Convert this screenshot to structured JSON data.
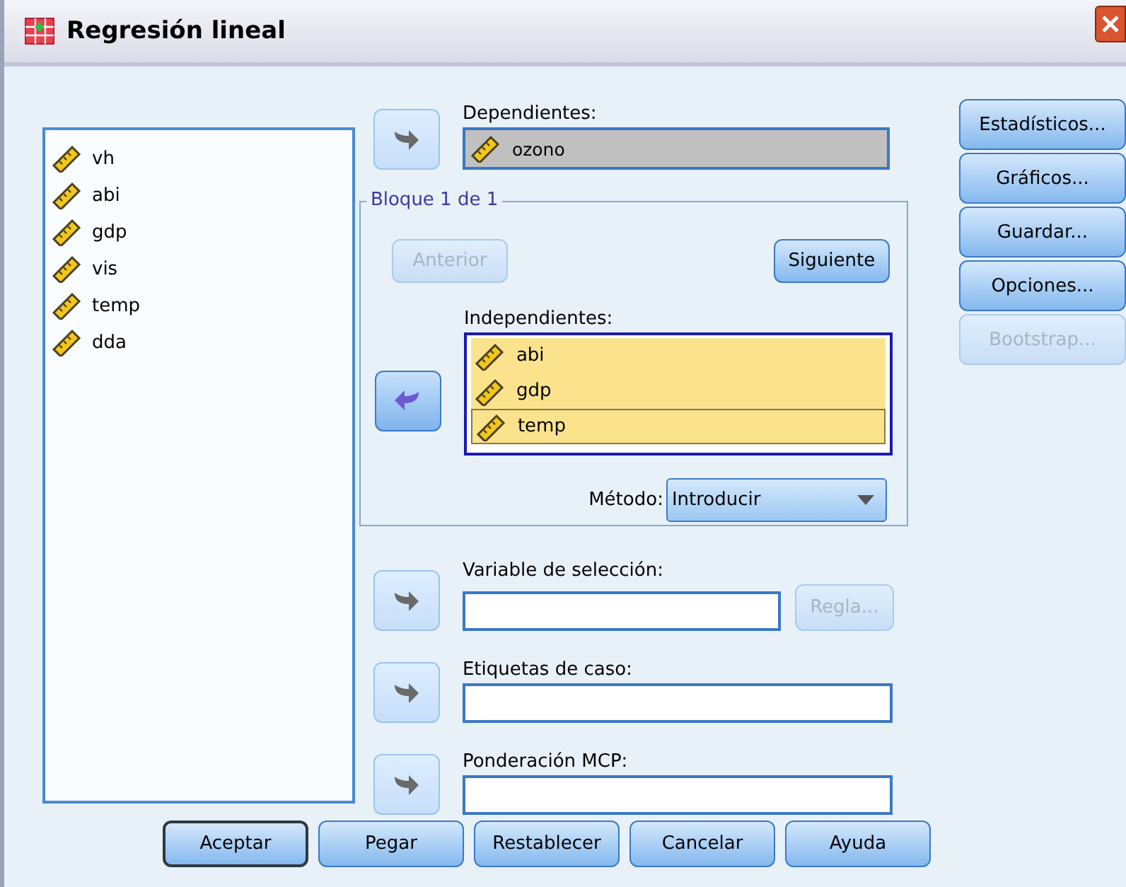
{
  "window": {
    "title": "Regresión lineal"
  },
  "source_variables": [
    {
      "name": "vh"
    },
    {
      "name": "abi"
    },
    {
      "name": "gdp"
    },
    {
      "name": "vis"
    },
    {
      "name": "temp"
    },
    {
      "name": "dda"
    }
  ],
  "dependent": {
    "label": "Dependientes:",
    "arrow_disabled": true,
    "value": "ozono"
  },
  "block": {
    "title": "Bloque 1 de 1",
    "previous": {
      "label": "Anterior",
      "disabled": true
    },
    "next": {
      "label": "Siguiente",
      "disabled": false
    },
    "independents_label": "Independientes:",
    "arrow_disabled": false,
    "independents": [
      {
        "name": "abi",
        "focused": false
      },
      {
        "name": "gdp",
        "focused": false
      },
      {
        "name": "temp",
        "focused": true
      }
    ],
    "method_label": "Método:",
    "method": "Introducir"
  },
  "selection": {
    "label": "Variable de selección:",
    "arrow_disabled": true,
    "rule_button": {
      "label": "Regla...",
      "disabled": true
    }
  },
  "case_labels": {
    "label": "Etiquetas de caso:",
    "arrow_disabled": true
  },
  "wls": {
    "label": "Ponderación MCP:",
    "arrow_disabled": true
  },
  "side_buttons": [
    {
      "label": "Estadísticos...",
      "disabled": false
    },
    {
      "label": "Gráficos...",
      "disabled": false
    },
    {
      "label": "Guardar...",
      "disabled": false
    },
    {
      "label": "Opciones...",
      "disabled": false
    },
    {
      "label": "Bootstrap...",
      "disabled": true
    }
  ],
  "bottom_buttons": [
    {
      "label": "Aceptar",
      "default": true
    },
    {
      "label": "Pegar",
      "default": false
    },
    {
      "label": "Restablecer",
      "default": false
    },
    {
      "label": "Cancelar",
      "default": false
    },
    {
      "label": "Ayuda",
      "default": false
    }
  ]
}
